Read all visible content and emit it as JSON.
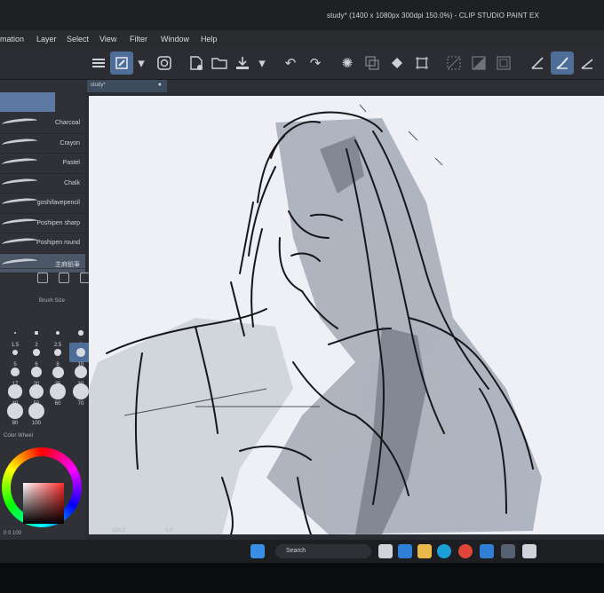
{
  "window": {
    "title": "study* (1400 x 1080px 300dpi 150.0%) - CLIP STUDIO PAINT EX"
  },
  "menu": [
    "mation",
    "Layer",
    "Select",
    "View",
    "Filter",
    "Window",
    "Help"
  ],
  "toolbar": {
    "icons": [
      "menu-icon",
      "pen-tool-icon",
      "dropdown-icon",
      "companion-icon",
      "new-file-icon",
      "open-folder-icon",
      "save-icon",
      "dropdown-icon",
      "undo-icon",
      "redo-icon",
      "loading-icon",
      "transform-icon",
      "fill-icon",
      "crop-icon",
      "deselect-icon",
      "invert-selection-icon",
      "show-area-icon",
      "line-icon",
      "brush-icon",
      "line-alt-icon"
    ]
  },
  "document_tab": {
    "label": "study*"
  },
  "brushes": {
    "items": [
      "Charcoal",
      "Crayon",
      "Pastel",
      "Chalk",
      "goshifavepencil",
      "Poshipen sharp",
      "Poshipen round",
      "芝麻鉛筆"
    ],
    "selected_index": 7
  },
  "brush_size": {
    "label": "Brush Size",
    "values": [
      "1.5",
      "2",
      "2.5",
      "3",
      "5",
      "6",
      "8",
      "10",
      "17",
      "20",
      "25",
      "30",
      "40",
      "50",
      "60",
      "70",
      "80",
      "100"
    ],
    "selected": "10"
  },
  "color": {
    "label": "Color Wheel",
    "values_text": "0  0  100"
  },
  "status": {
    "zoom": "150.0",
    "angle": "0.0"
  },
  "taskbar": {
    "search_label": "Search"
  }
}
